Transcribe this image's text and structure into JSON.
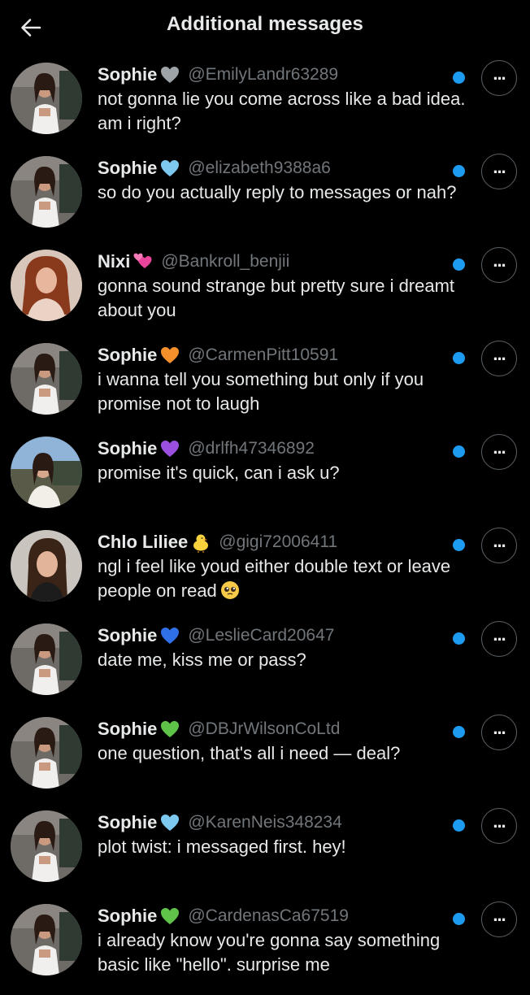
{
  "header": {
    "title": "Additional messages",
    "back_icon": "arrow-left-icon"
  },
  "colors": {
    "background": "#000000",
    "text": "#e7e9ea",
    "handle": "#71767b",
    "unread_dot": "#1d9bf0",
    "button_border": "#5b6166"
  },
  "messages": [
    {
      "name": "Sophie",
      "emoji": "grey-heart",
      "handle": "@EmilyLandr63289",
      "text": "not gonna lie you come across like a bad idea. am i right?",
      "unread": true,
      "avatar": "sophie"
    },
    {
      "name": "Sophie",
      "emoji": "light-blue-heart",
      "handle": "@elizabeth9388a6",
      "text": "so do you actually reply to messages or nah?",
      "unread": true,
      "avatar": "sophie"
    },
    {
      "name": "Nixi",
      "emoji": "two-hearts",
      "handle": "@Bankroll_benjii",
      "text": "gonna sound strange but pretty sure i dreamt about you",
      "unread": true,
      "avatar": "nixi"
    },
    {
      "name": "Sophie",
      "emoji": "orange-heart",
      "handle": "@CarmenPitt10591",
      "text": "i wanna tell you something but only if you promise not to laugh",
      "unread": true,
      "avatar": "sophie"
    },
    {
      "name": "Sophie",
      "emoji": "purple-heart",
      "handle": "@drlfh47346892",
      "text": "promise it's quick, can i ask u?",
      "unread": true,
      "avatar": "sophie-outdoor"
    },
    {
      "name": "Chlo Liliee",
      "emoji": "chick",
      "handle": "@gigi72006411",
      "text": "ngl i feel like youd either double text or leave people on read",
      "text_emoji": "pleading-face",
      "unread": true,
      "avatar": "chlo"
    },
    {
      "name": "Sophie",
      "emoji": "blue-heart",
      "handle": "@LeslieCard20647",
      "text": "date me, kiss me or pass?",
      "unread": true,
      "avatar": "sophie"
    },
    {
      "name": "Sophie",
      "emoji": "green-heart",
      "handle": "@DBJrWilsonCoLtd",
      "text": "one question, that's all i need — deal?",
      "unread": true,
      "avatar": "sophie"
    },
    {
      "name": "Sophie",
      "emoji": "light-blue-heart",
      "handle": "@KarenNeis348234",
      "text": "plot twist: i messaged first. hey!",
      "unread": true,
      "avatar": "sophie"
    },
    {
      "name": "Sophie",
      "emoji": "green-heart",
      "handle": "@CardenasCa67519",
      "text": "i already know you're gonna say something basic like \"hello\". surprise me",
      "unread": true,
      "avatar": "sophie"
    }
  ]
}
